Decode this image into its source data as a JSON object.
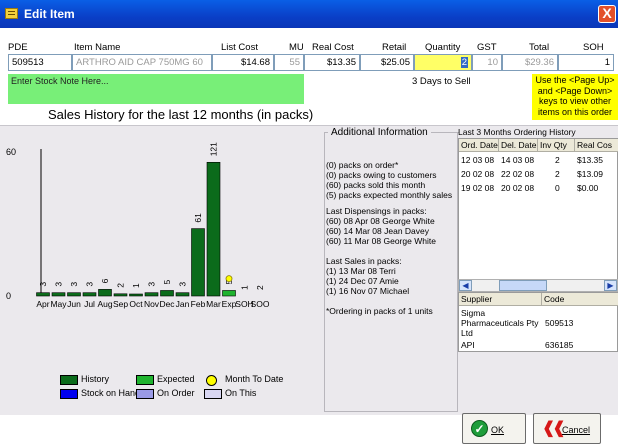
{
  "window": {
    "title": "Edit Item",
    "close_glyph": "X"
  },
  "header": {
    "columns": [
      "PDE",
      "Item Name",
      "List Cost",
      "MU",
      "Real Cost",
      "Retail",
      "Quantity",
      "GST",
      "Total",
      "SOH"
    ],
    "pde": "509513",
    "item_name": "ARTHRO AID CAP 750MG 60",
    "list_cost": "$14.68",
    "mu": "55",
    "real_cost": "$13.35",
    "retail": "$25.05",
    "quantity": "2",
    "gst": "10",
    "total": "$29.36",
    "soh": "1"
  },
  "stock_note": {
    "placeholder": "Enter Stock Note Here..."
  },
  "days_to_sell": "3 Days to Sell",
  "page_tip": [
    "Use the <Page Up>",
    "and <Page Down>",
    "keys to view other",
    "items on this order"
  ],
  "sales_history_title": "Sales History for the last 12 months (in packs)",
  "chart_data": {
    "type": "bar",
    "categories": [
      "Apr",
      "May",
      "Jun",
      "Jul",
      "Aug",
      "Sep",
      "Oct",
      "Nov",
      "Dec",
      "Jan",
      "Feb",
      "Mar",
      "Exp",
      "SOH",
      "SOO"
    ],
    "series": [
      {
        "name": "History",
        "values": [
          3,
          3,
          3,
          3,
          6,
          2,
          1,
          3,
          5,
          3,
          61,
          121,
          null,
          null,
          null
        ]
      },
      {
        "name": "Expected",
        "values": [
          null,
          null,
          null,
          null,
          null,
          null,
          null,
          null,
          null,
          null,
          null,
          null,
          5,
          null,
          null
        ]
      }
    ],
    "data_labels": [
      "3",
      "3",
      "3",
      "3",
      "6",
      "2",
      "1",
      "3",
      "5",
      "3",
      "61",
      "121",
      "5",
      "1",
      "2"
    ],
    "month_to_date": 13,
    "y_axis_visible_ticks": [
      "60",
      "0"
    ],
    "ylim": [
      0,
      150
    ],
    "grid": false,
    "legend": [
      {
        "label": "History",
        "color": "#0b6b1b",
        "shape": "rect"
      },
      {
        "label": "Expected",
        "color": "#1fb32f",
        "shape": "rect"
      },
      {
        "label": "Month To Date",
        "color": "#ffff00",
        "shape": "circle"
      },
      {
        "label": "Stock on Hand",
        "color": "#0000ee",
        "shape": "rect"
      },
      {
        "label": "On Order",
        "color": "#9a9ae6",
        "shape": "rect"
      },
      {
        "label": "On This",
        "color": "#d8d6f2",
        "shape": "rect"
      }
    ],
    "colors": {
      "history": "#0b6b1b",
      "expected": "#1fb32f",
      "month_to_date": "#ffff00"
    }
  },
  "additional_info": {
    "title": "Additional Information",
    "block1": [
      "(0) packs on order*",
      "(0) packs owing to customers",
      "(60) packs sold this month",
      "(5) packs expected monthly sales"
    ],
    "block2_title": "Last Dispensings in packs:",
    "block2": [
      "(60) 08 Apr 08 George White",
      "(60) 14 Mar 08 Jean Davey",
      "(60) 11 Mar 08 George White"
    ],
    "block3_title": "Last Sales in packs:",
    "block3": [
      "(1) 13 Mar 08 Terri",
      "(1) 24 Dec 07 Amie",
      "(1) 16 Nov 07 Michael"
    ],
    "footnote": "*Ordering in packs of 1 units"
  },
  "ordering_history": {
    "title": "Last 3 Months Ordering History",
    "columns": [
      "Ord. Date",
      "Del. Date",
      "Inv Qty",
      "Real Cos"
    ],
    "rows": [
      [
        "12 03 08",
        "14 03 08",
        "2",
        "$13.35"
      ],
      [
        "20 02 08",
        "22 02 08",
        "2",
        "$13.09"
      ],
      [
        "19 02 08",
        "20 02 08",
        "0",
        "$0.00"
      ]
    ]
  },
  "suppliers": {
    "columns": [
      "Supplier",
      "Code"
    ],
    "rows": [
      [
        "Sigma Pharmaceuticals Pty Ltd",
        "509513"
      ],
      [
        "API",
        "636185"
      ]
    ]
  },
  "buttons": {
    "ok": "OK",
    "cancel": "Cancel"
  },
  "icons": {
    "title": "window-icon",
    "close": "close-icon",
    "ok": "checkmark-icon",
    "cancel": "cancel-icon"
  }
}
